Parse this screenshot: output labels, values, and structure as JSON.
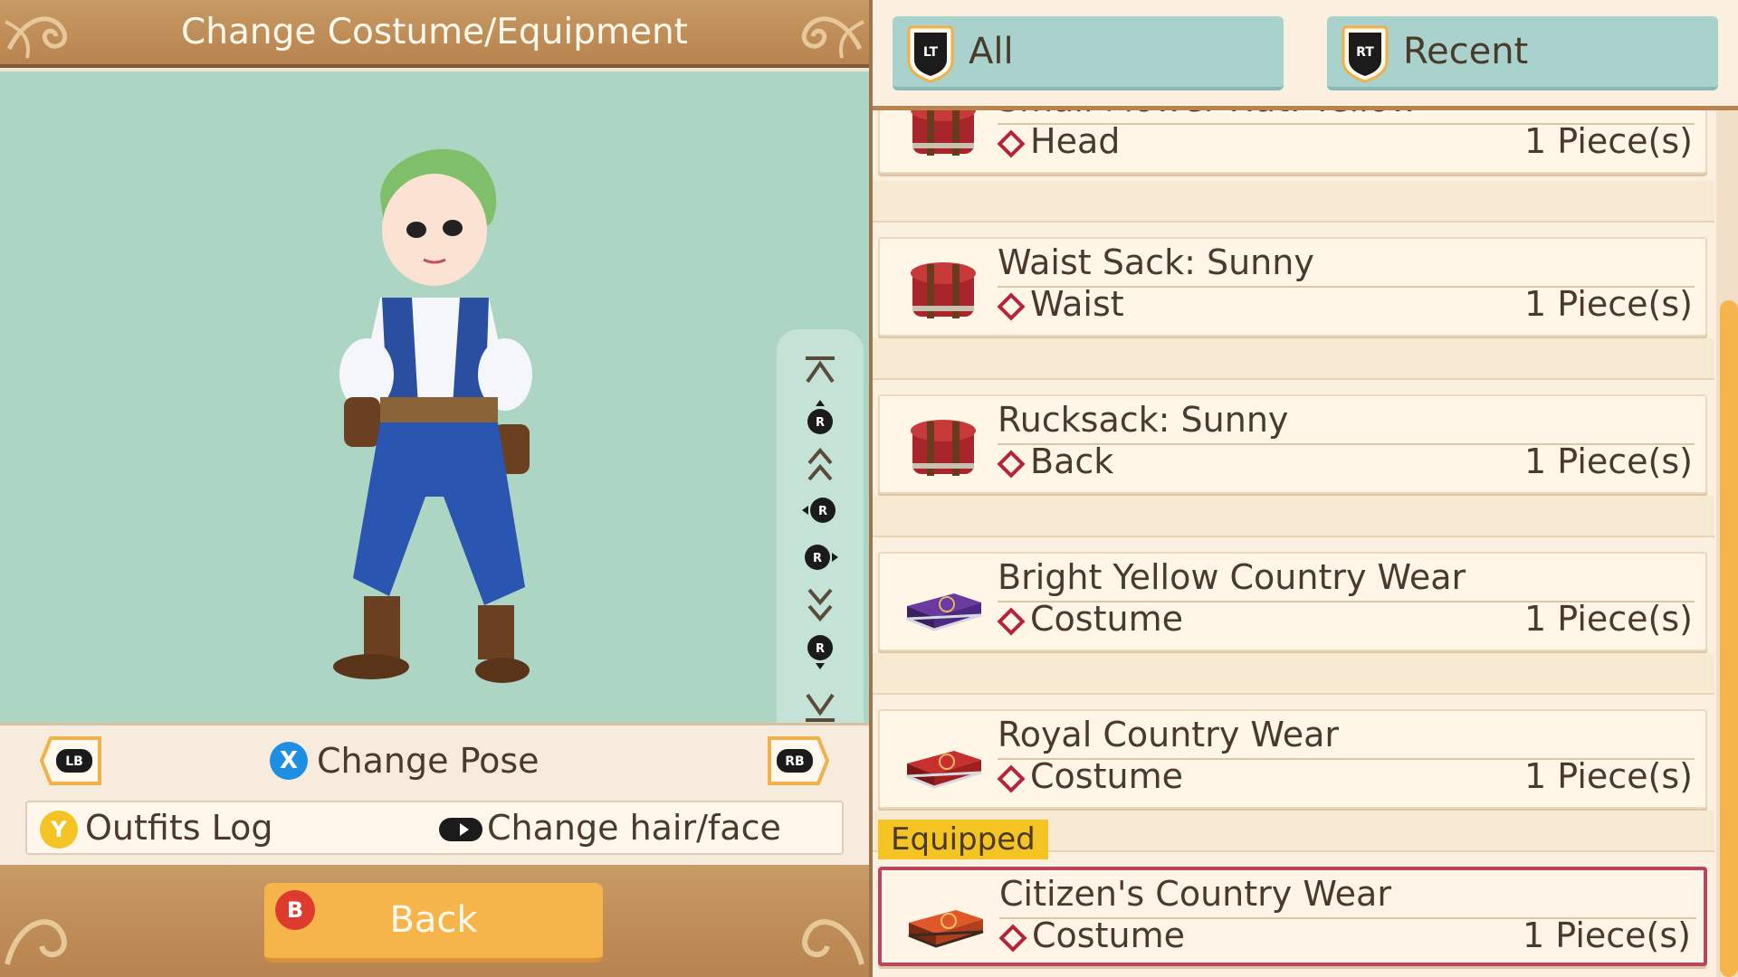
{
  "window": {
    "title": "Change Costume/Equipment"
  },
  "character": {
    "hair_color": "#7fbf6a",
    "vest_color": "#2a4fa0",
    "pants_color": "#2a55b0"
  },
  "controls": {
    "lb": "LB",
    "rb": "RB",
    "change_pose_key": "X",
    "change_pose": "Change Pose",
    "outfits_log_key": "Y",
    "outfits_log": "Outfits Log",
    "change_hair_face": "Change hair/face",
    "back_key": "B",
    "back": "Back"
  },
  "camera_controls": [
    {
      "icon": "top-icon"
    },
    {
      "icon": "rotate-up-icon"
    },
    {
      "icon": "zoom-in-icon"
    },
    {
      "icon": "rotate-left-icon"
    },
    {
      "icon": "rotate-right-icon"
    },
    {
      "icon": "zoom-out-icon"
    },
    {
      "icon": "rotate-down-icon"
    },
    {
      "icon": "bottom-icon"
    }
  ],
  "tabs": [
    {
      "key": "LT",
      "label": "All"
    },
    {
      "key": "RT",
      "label": "Recent"
    }
  ],
  "items": [
    {
      "name": "Small Flower Hat: Yellow",
      "slot": "Head",
      "qty": "1 Piece(s)",
      "icon": "red-box-icon"
    },
    {
      "name": "Waist Sack:  Sunny",
      "slot": "Waist",
      "qty": "1 Piece(s)",
      "icon": "red-box-icon"
    },
    {
      "name": "Rucksack: Sunny",
      "slot": "Back",
      "qty": "1 Piece(s)",
      "icon": "red-box-icon"
    },
    {
      "name": "Bright Yellow Country Wear",
      "slot": "Costume",
      "qty": "1 Piece(s)",
      "icon": "purple-case-icon"
    },
    {
      "name": "Royal Country Wear",
      "slot": "Costume",
      "qty": "1 Piece(s)",
      "icon": "red-case-icon"
    },
    {
      "name": "Citizen's Country Wear",
      "slot": "Costume",
      "qty": "1 Piece(s)",
      "icon": "orange-case-icon"
    }
  ],
  "equipped_label": "Equipped",
  "colors": {
    "accent_orange": "#f6b54a",
    "tab_teal": "#a8d2cb",
    "stage_mint": "#acd5c3",
    "equipped_border": "#b94660",
    "equipped_tag": "#f3c423",
    "diamond_red": "#b3263a"
  }
}
